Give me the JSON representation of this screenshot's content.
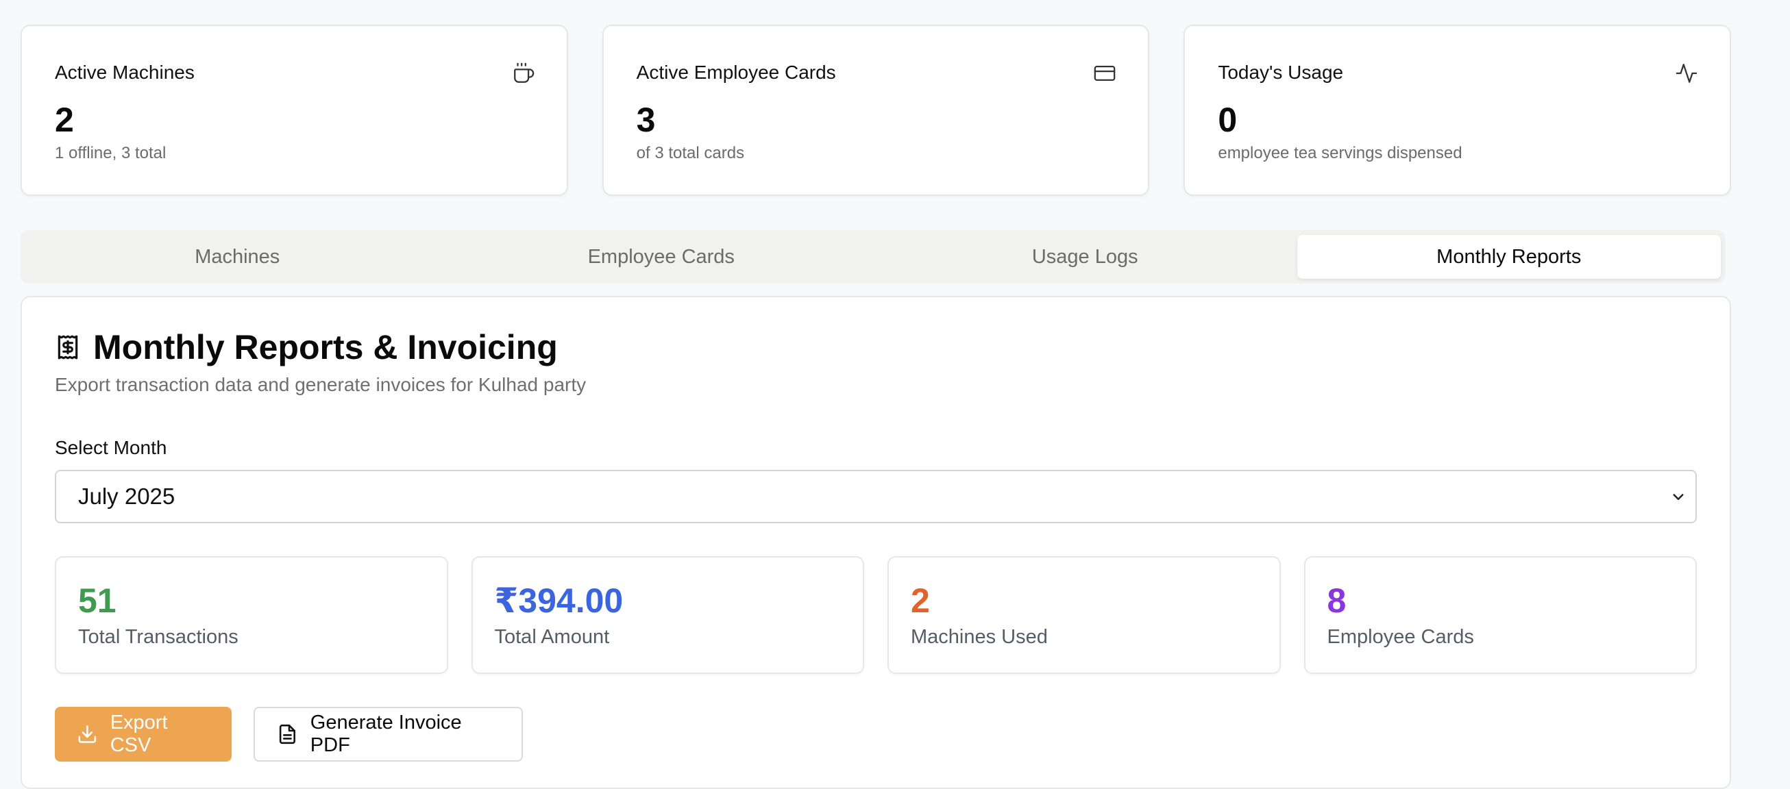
{
  "stats": [
    {
      "title": "Active Machines",
      "value": "2",
      "sub": "1 offline, 3 total",
      "icon": "coffee-icon"
    },
    {
      "title": "Active Employee Cards",
      "value": "3",
      "sub": "of 3 total cards",
      "icon": "credit-card-icon"
    },
    {
      "title": "Today's Usage",
      "value": "0",
      "sub": "employee tea servings dispensed",
      "icon": "activity-icon"
    }
  ],
  "tabs": [
    {
      "label": "Machines",
      "active": false
    },
    {
      "label": "Employee Cards",
      "active": false
    },
    {
      "label": "Usage Logs",
      "active": false
    },
    {
      "label": "Monthly Reports",
      "active": true
    }
  ],
  "report": {
    "title": "Monthly Reports & Invoicing",
    "description": "Export transaction data and generate invoices for Kulhad party",
    "month_label": "Select Month",
    "selected_month": "July 2025",
    "metrics": [
      {
        "value": "51",
        "label": "Total Transactions",
        "color": "#3f9c4f"
      },
      {
        "value": "₹394.00",
        "label": "Total Amount",
        "color": "#3c64de"
      },
      {
        "value": "2",
        "label": "Machines Used",
        "color": "#e0642a"
      },
      {
        "value": "8",
        "label": "Employee Cards",
        "color": "#8a35de"
      }
    ],
    "export_csv_label": "Export CSV",
    "generate_pdf_label": "Generate Invoice PDF"
  }
}
